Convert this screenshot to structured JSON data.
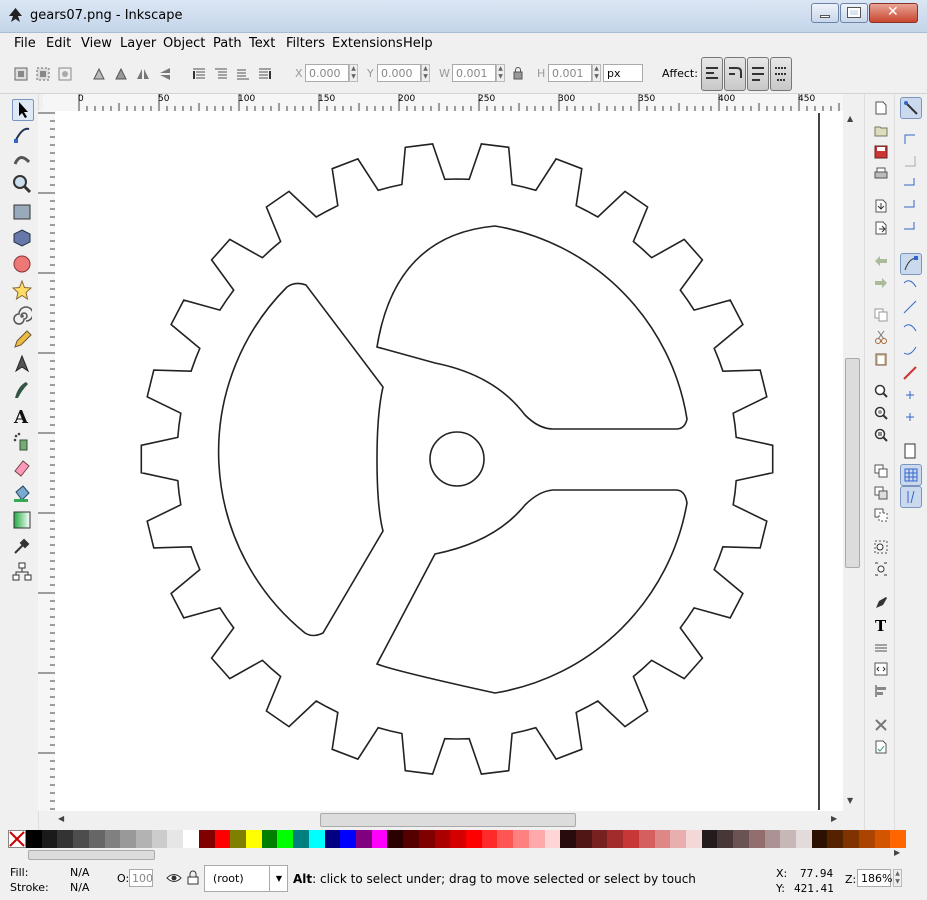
{
  "window": {
    "title": "gears07.png - Inkscape"
  },
  "menu": [
    "File",
    "Edit",
    "View",
    "Layer",
    "Object",
    "Path",
    "Text",
    "Filters",
    "Extensions",
    "Help"
  ],
  "toolbar": {
    "x_label": "X",
    "x_value": "0.000",
    "y_label": "Y",
    "y_value": "0.000",
    "w_label": "W",
    "w_value": "0.001",
    "h_label": "H",
    "h_value": "0.001",
    "unit": "px",
    "affect_label": "Affect:"
  },
  "ruler": {
    "h_ticks": [
      "0",
      "50",
      "100",
      "150",
      "200",
      "250",
      "300",
      "350",
      "400",
      "450"
    ],
    "v_ticks": [
      "450",
      "400",
      "350",
      "300",
      "250",
      "200",
      "150",
      "100",
      "50"
    ]
  },
  "tools": [
    "selector-tool",
    "node-tool",
    "tweak-tool",
    "zoom-tool",
    "rect-tool",
    "box3d-tool",
    "ellipse-tool",
    "star-tool",
    "spiral-tool",
    "pencil-tool",
    "pen-tool",
    "calligraphy-tool",
    "text-tool",
    "spray-tool",
    "eraser-tool",
    "bucket-tool",
    "gradient-tool",
    "dropper-tool",
    "connector-tool"
  ],
  "palette": [
    "#000000",
    "#1a1a1a",
    "#333333",
    "#4d4d4d",
    "#666666",
    "#808080",
    "#999999",
    "#b3b3b3",
    "#cccccc",
    "#e6e6e6",
    "#ffffff",
    "#800000",
    "#ff0000",
    "#808000",
    "#ffff00",
    "#008000",
    "#00ff00",
    "#008080",
    "#00ffff",
    "#000080",
    "#0000ff",
    "#800080",
    "#ff00ff",
    "#2b0000",
    "#550000",
    "#800000",
    "#aa0000",
    "#d40000",
    "#ff0000",
    "#ff2a2a",
    "#ff5555",
    "#ff8080",
    "#ffaaaa",
    "#ffd5d5",
    "#280b0b",
    "#501616",
    "#782121",
    "#a02c2c",
    "#c83737",
    "#d35f5f",
    "#de8787",
    "#e9afaf",
    "#f4d7d7",
    "#241c1c",
    "#483737",
    "#6c5353",
    "#916f6f",
    "#ac9393",
    "#c8b7b7",
    "#e3dbdb",
    "#2b1100",
    "#552200",
    "#803300",
    "#aa4400",
    "#d45500",
    "#ff6600"
  ],
  "status": {
    "fill_label": "Fill:",
    "fill_value": "N/A",
    "stroke_label": "Stroke:",
    "stroke_value": "N/A",
    "opacity_label": "O:",
    "opacity_value": "100",
    "layer": "(root)",
    "message_key": "Alt",
    "message": ": click to select under; drag to move selected or select by touch",
    "x_label": "X:",
    "x_value": "77.94",
    "y_label": "Y:",
    "y_value": "421.41",
    "zoom_label": "Z:",
    "zoom_value": "186%"
  }
}
